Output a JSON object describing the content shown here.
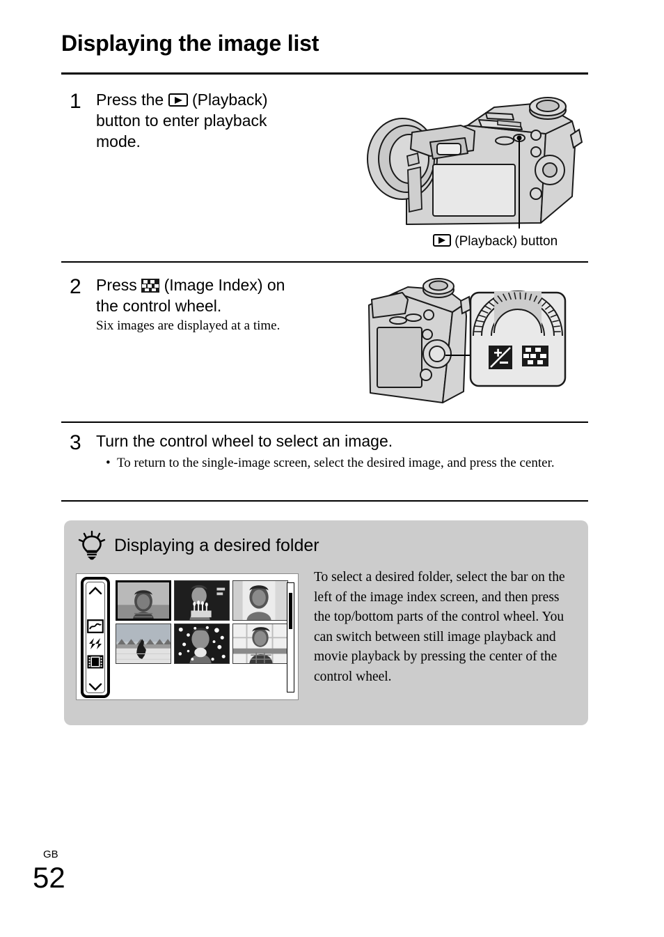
{
  "page": {
    "title": "Displaying the image list",
    "footer_region": "GB",
    "footer_page_number": "52",
    "tip_background_color": "#cccccc"
  },
  "steps": [
    {
      "number": "1",
      "text_before_icon": "Press the",
      "icon": "playback-icon",
      "text_after_icon": "(Playback)",
      "line2": "button to enter playback",
      "line3": "mode.",
      "illustration_alt": "camera-rear-view-with-lens",
      "caption_icon": "playback-icon",
      "caption_text": "(Playback) button"
    },
    {
      "number": "2",
      "text_before_icon": "Press",
      "icon": "image-index-icon",
      "text_after_icon": "(Image Index) on",
      "line2": "the control wheel.",
      "subtext": "Six images are displayed at a time.",
      "illustration_alt": "camera-back-with-control-wheel-callout",
      "callout_icons": [
        "exposure-compensation-icon",
        "image-index-icon"
      ]
    },
    {
      "number": "3",
      "heading": "Turn the control wheel to select an image.",
      "bullet": "To return to the single-image screen, select the desired image, and press the center."
    }
  ],
  "tip": {
    "icon": "light-bulb-icon",
    "heading": "Displaying a desired folder",
    "body": "To select a desired folder, select the bar on the left of the image index screen, and then press the top/bottom parts of the control wheel. You can switch between still image playback and movie playback by pressing the center of the control wheel.",
    "screen": {
      "sidebar_icons": [
        "chevron-up-icon",
        "still-image-icon",
        "switch-playback-icon",
        "movie-film-icon",
        "chevron-down-icon"
      ],
      "thumbnail_count": 6,
      "selected_thumbnail_index": 0,
      "scrollbar": "vertical-scrollbar"
    }
  }
}
